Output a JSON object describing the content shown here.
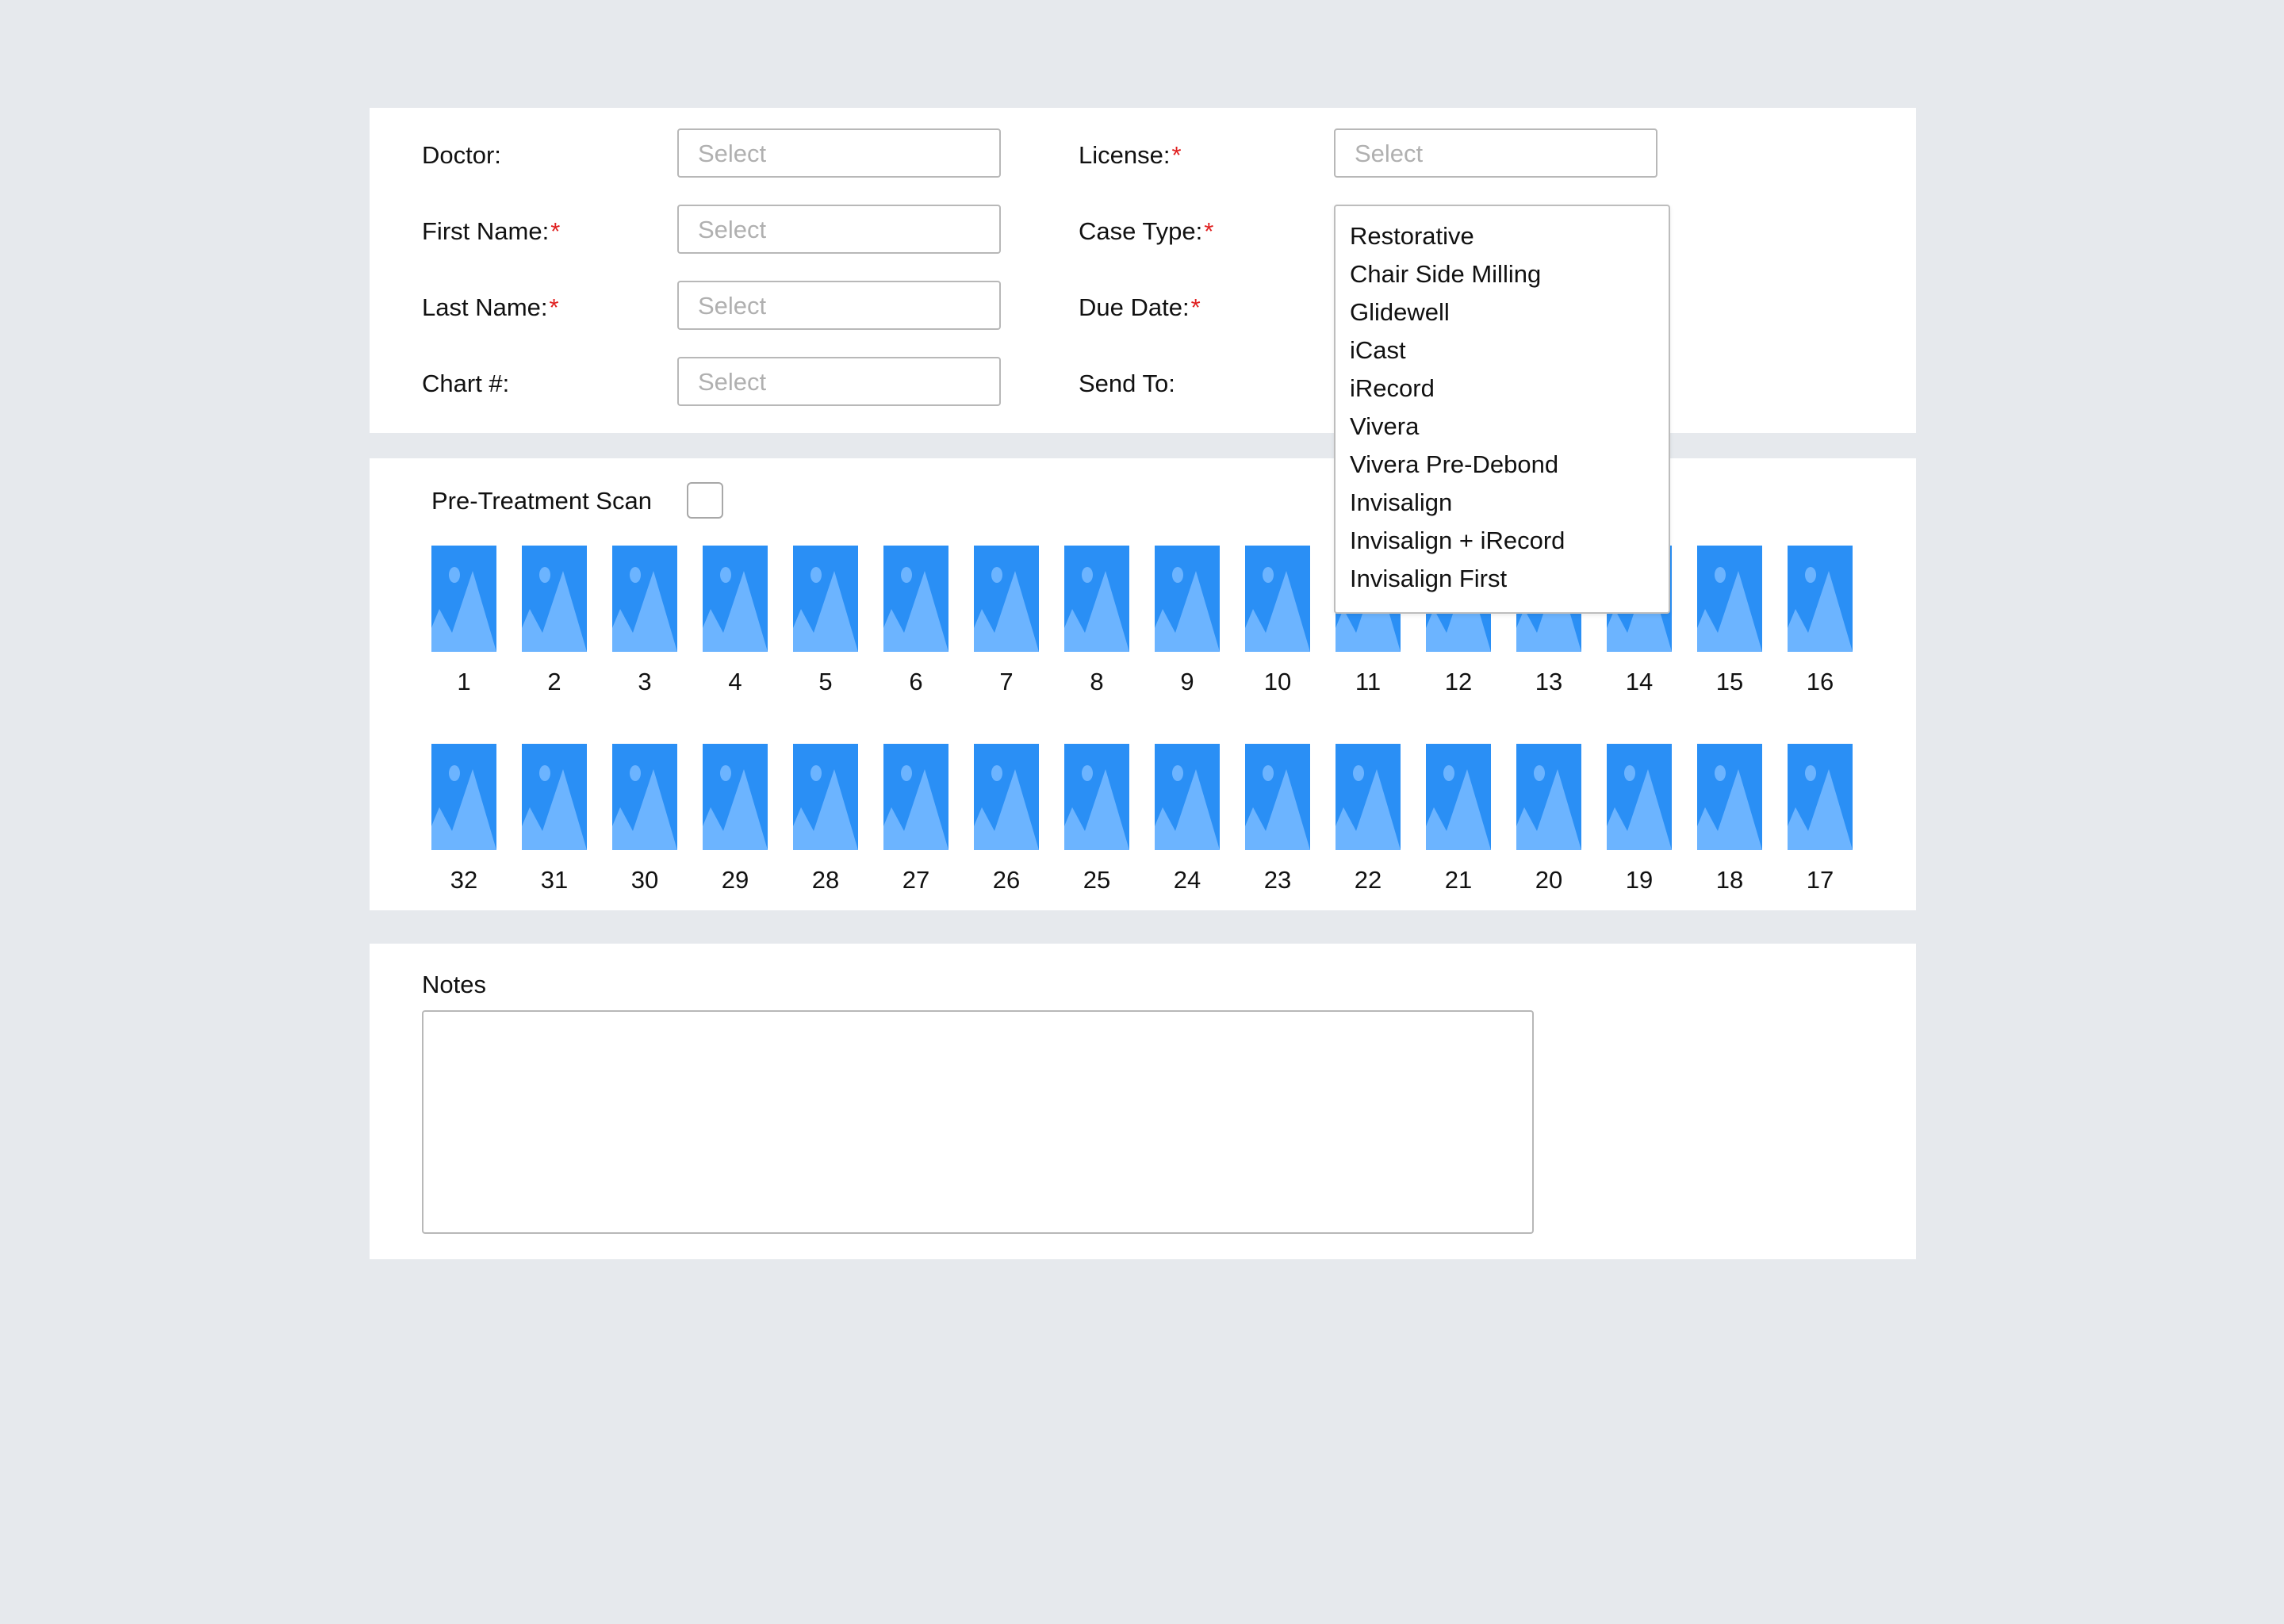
{
  "form": {
    "left_fields": [
      {
        "label": "Doctor:",
        "required": false,
        "placeholder": "Select"
      },
      {
        "label": "First Name:",
        "required": true,
        "placeholder": "Select"
      },
      {
        "label": "Last Name:",
        "required": true,
        "placeholder": "Select"
      },
      {
        "label": "Chart #:",
        "required": false,
        "placeholder": "Select"
      }
    ],
    "right_fields": [
      {
        "label": "License:",
        "required": true,
        "placeholder": "Select"
      },
      {
        "label": "Case Type:",
        "required": true
      },
      {
        "label": "Due Date:",
        "required": true
      },
      {
        "label": "Send To:",
        "required": false
      }
    ],
    "required_marker": "*"
  },
  "case_type_dropdown": {
    "options": [
      "Restorative",
      "Chair Side Milling",
      "Glidewell",
      "iCast",
      "iRecord",
      "Vivera",
      "Vivera Pre-Debond",
      "Invisalign",
      "Invisalign + iRecord",
      "Invisalign First"
    ]
  },
  "teeth": {
    "pre_treatment_label": "Pre-Treatment Scan",
    "pre_treatment_checked": false,
    "upper": [
      "1",
      "2",
      "3",
      "4",
      "5",
      "6",
      "7",
      "8",
      "9",
      "10",
      "11",
      "12",
      "13",
      "14",
      "15",
      "16"
    ],
    "lower": [
      "32",
      "31",
      "30",
      "29",
      "28",
      "27",
      "26",
      "25",
      "24",
      "23",
      "22",
      "21",
      "20",
      "19",
      "18",
      "17"
    ],
    "icon": "image-placeholder-icon"
  },
  "notes": {
    "label": "Notes",
    "value": ""
  },
  "colors": {
    "background": "#e6e9ed",
    "panel": "#ffffff",
    "required": "#e02020",
    "image_blue": "#2a8ff5",
    "image_light": "#6cb4ff"
  }
}
